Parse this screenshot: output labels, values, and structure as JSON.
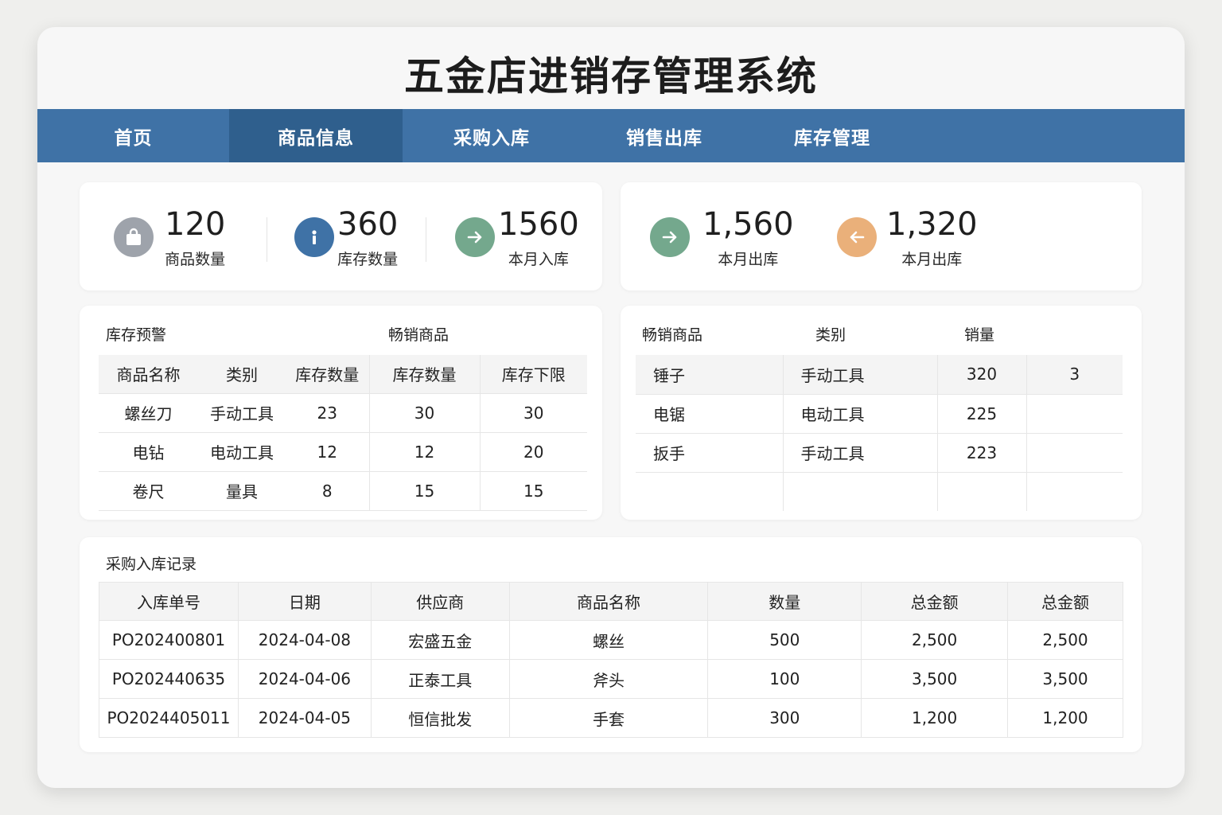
{
  "app": {
    "title": "五金店进销存管理系统"
  },
  "nav": {
    "items": [
      {
        "label": "首页",
        "active": false
      },
      {
        "label": "商品信息",
        "active": true
      },
      {
        "label": "采购入库",
        "active": false
      },
      {
        "label": "销售出库",
        "active": false
      },
      {
        "label": "库存管理",
        "active": false
      }
    ]
  },
  "stats": {
    "product_count": {
      "value": "120",
      "label": "商品数量",
      "icon": "shopping-bag-icon",
      "color": "#9ea3ab"
    },
    "stock_count": {
      "value": "360",
      "label": "库存数量",
      "icon": "info-icon",
      "color": "#3f72a6"
    },
    "month_in": {
      "value": "1560",
      "label": "本月入库",
      "icon": "arrow-right-icon",
      "color": "#74a88d"
    },
    "month_out_1": {
      "value": "1,560",
      "label": "本月出库",
      "icon": "arrow-right-icon",
      "color": "#74a88d"
    },
    "month_out_2": {
      "value": "1,320",
      "label": "本月出库",
      "icon": "arrow-left-icon",
      "color": "#eab07a"
    }
  },
  "stock_panel": {
    "title": "库存预警",
    "subtitle": "畅销商品",
    "columns": [
      "商品名称",
      "类别",
      "库存数量",
      "库存数量",
      "库存下限"
    ],
    "rows": [
      [
        "螺丝刀",
        "手动工具",
        "23",
        "30",
        "30"
      ],
      [
        "电钻",
        "电动工具",
        "12",
        "12",
        "20"
      ],
      [
        "卷尺",
        "量具",
        "8",
        "15",
        "15"
      ]
    ]
  },
  "bestseller_panel": {
    "columns": [
      "畅销商品",
      "类别",
      "销量",
      ""
    ],
    "rows": [
      [
        "锤子",
        "手动工具",
        "320",
        "3"
      ],
      [
        "电锯",
        "电动工具",
        "225",
        ""
      ],
      [
        "扳手",
        "手动工具",
        "223",
        ""
      ],
      [
        "",
        "",
        "",
        ""
      ]
    ]
  },
  "purchase_panel": {
    "title": "采购入库记录",
    "columns": [
      "入库单号",
      "日期",
      "供应商",
      "商品名称",
      "数量",
      "总金额",
      "总金额"
    ],
    "rows": [
      [
        "PO202400801",
        "2024-04-08",
        "宏盛五金",
        "螺丝",
        "500",
        "2,500",
        "2,500"
      ],
      [
        "PO202440635",
        "2024-04-06",
        "正泰工具",
        "斧头",
        "100",
        "3,500",
        "3,500"
      ],
      [
        "PO2024405011",
        "2024-04-05",
        "恒信批发",
        "手套",
        "300",
        "1,200",
        "1,200"
      ]
    ]
  }
}
